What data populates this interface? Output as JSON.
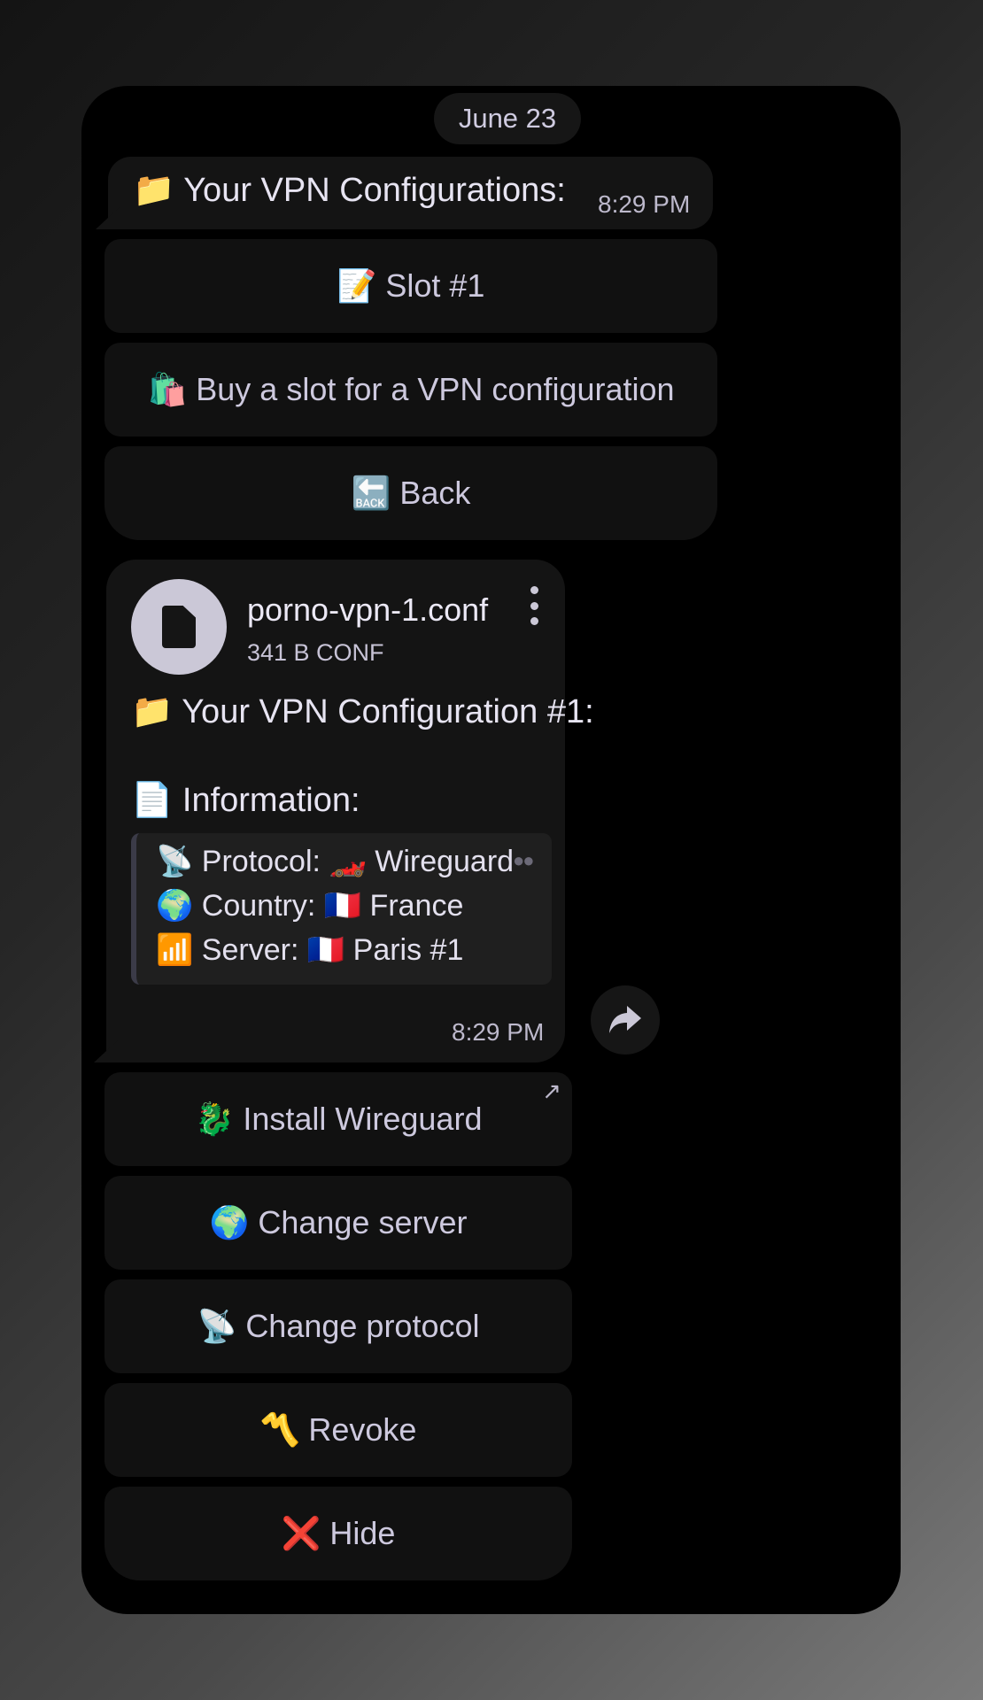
{
  "chat": {
    "date": "June 23",
    "message1": {
      "icon": "📁",
      "text": "Your VPN Configurations:",
      "time": "8:29 PM"
    },
    "keyboard1": [
      {
        "emoji": "📝",
        "label": "Slot #1"
      },
      {
        "emoji": "🛍️",
        "label": "Buy a slot for a VPN configuration"
      },
      {
        "emoji": "🔙",
        "label": "Back"
      }
    ],
    "file": {
      "name": "porno-vpn-1.conf",
      "meta": "341 B CONF",
      "icon": "document-icon"
    },
    "message2": {
      "title_icon": "📁",
      "title": "Your VPN Configuration #1:",
      "info_icon": "📄",
      "info": "Information:",
      "time": "8:29 PM"
    },
    "quote": [
      {
        "emoji": "📡",
        "label": "Protocol:",
        "vemoji": "🏎️",
        "value": "Wireguard"
      },
      {
        "emoji": "🌍",
        "label": "Country:",
        "vemoji": "🇫🇷",
        "value": "France"
      },
      {
        "emoji": "📶",
        "label": "Server:",
        "vemoji": "🇫🇷",
        "value": "Paris #1"
      }
    ],
    "keyboard2": [
      {
        "emoji": "🐉",
        "label": "Install Wireguard"
      },
      {
        "emoji": "🌍",
        "label": "Change server"
      },
      {
        "emoji": "📡",
        "label": "Change protocol"
      },
      {
        "emoji": "〽️",
        "label": "Revoke"
      },
      {
        "emoji": "❌",
        "label": "Hide"
      }
    ]
  },
  "colors": {
    "background": "#000000",
    "bubble": "#141414",
    "button": "#111111",
    "text": "#e7e4f2"
  }
}
